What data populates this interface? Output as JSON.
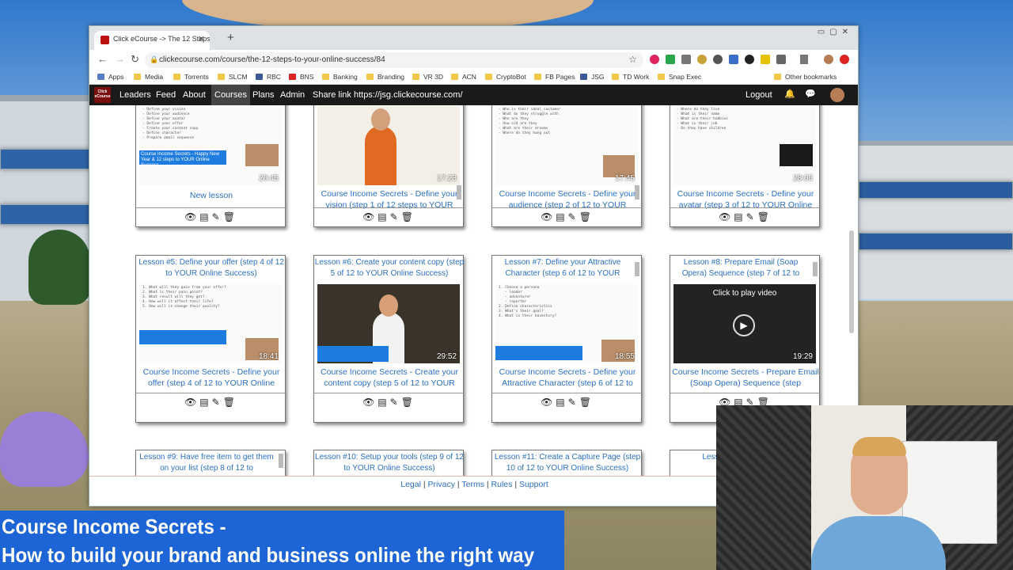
{
  "browser": {
    "tab_title": "Click eCourse -> The 12 Steps to",
    "url": "clickecourse.com/course/the-12-steps-to-your-online-success/84",
    "bookmarks": [
      "Apps",
      "Media",
      "Torrents",
      "SLCM",
      "RBC",
      "BNS",
      "Banking",
      "Branding",
      "VR 3D",
      "ACN",
      "CryptoBot",
      "FB Pages",
      "JSG",
      "TD Work",
      "Snap Exec"
    ],
    "other_bookmarks": "Other bookmarks"
  },
  "sitenav": {
    "logo": "Click eCourse",
    "links": [
      "Leaders",
      "Feed",
      "About",
      "Courses",
      "Plans",
      "Admin"
    ],
    "share": "Share link https://jsg.clickecourse.com/",
    "logout": "Logout"
  },
  "row1": [
    {
      "sub": "New lesson",
      "dur": "20:45",
      "bar": "Course Income Secrets - Happy New Year & 12 steps to YOUR Online Success"
    },
    {
      "sub": "Course Income Secrets - Define your vision (step 1 of 12 steps to YOUR",
      "dur": "17:23"
    },
    {
      "sub": "Course Income Secrets - Define your audience (step 2 of 12 to YOUR",
      "dur": "17:45"
    },
    {
      "sub": "Course Income Secrets - Define your avatar (step 3 of 12 to YOUR Online",
      "dur": "28:05"
    }
  ],
  "row2": [
    {
      "title": "Lesson #5: Define your offer (step 4 of 12 to YOUR Online Success)",
      "sub": "Course Income Secrets - Define your offer (step 4 of 12 to YOUR Online",
      "dur": "18:41"
    },
    {
      "title": "Lesson #6: Create your content copy (step 5 of 12 to YOUR Online Success)",
      "sub": "Course Income Secrets - Create your content copy (step 5 of 12 to YOUR",
      "dur": "29:52"
    },
    {
      "title": "Lesson #7: Define your Attractive Character (step 6 of 12 to YOUR",
      "sub": "Course Income Secrets - Define your Attractive Character (step 6 of 12 to",
      "dur": "18:55"
    },
    {
      "title": "Lesson #8: Prepare Email (Soap Opera) Sequence (step 7 of 12 to",
      "sub": "Course Income Secrets - Prepare Email (Soap Opera) Sequence (step",
      "dur": "19:29",
      "play": "Click to play video"
    }
  ],
  "row3": [
    {
      "title": "Lesson #9: Have free item to get them on your list (step 8 of 12 to"
    },
    {
      "title": "Lesson #10: Setup your tools (step 9 of 12 to YOUR Online Success)"
    },
    {
      "title": "Lesson #11: Create a Capture Page (step 10 of 12 to YOUR Online Success)"
    },
    {
      "title": "Lesson #12 (step 11 of 1"
    }
  ],
  "footer": [
    "Legal",
    "Privacy",
    "Terms",
    "Rules",
    "Support"
  ],
  "caption": {
    "line1": "Course Income Secrets -",
    "line2": "How to build your brand and business online the right way"
  },
  "colors": {
    "accent": "#2b6fc4",
    "nav": "#1a1a1a",
    "caption": "#1d64d6"
  }
}
